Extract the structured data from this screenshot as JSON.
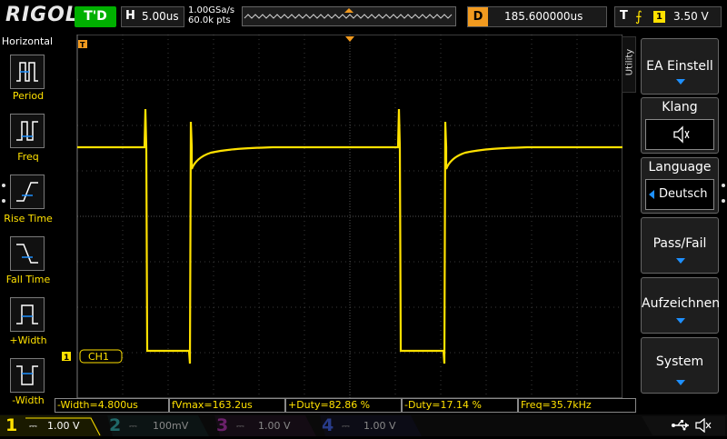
{
  "header": {
    "logo": "RIGOL",
    "run_status": "T'D",
    "timebase_label": "H",
    "timebase_value": "5.00us",
    "sample_rate": "1.00GSa/s",
    "memory_depth": "60.0k pts",
    "delay_label": "D",
    "delay_value": "185.600000us",
    "trigger_label": "T",
    "trigger_edge": "⨍",
    "trigger_channel": "1",
    "trigger_level": "3.50 V"
  },
  "left_panel": {
    "title": "Horizontal",
    "items": [
      {
        "label": "Period",
        "icon": "period-icon"
      },
      {
        "label": "Freq",
        "icon": "frequency-icon"
      },
      {
        "label": "Rise Time",
        "icon": "rise-time-icon"
      },
      {
        "label": "Fall Time",
        "icon": "fall-time-icon"
      },
      {
        "label": "+Width",
        "icon": "positive-width-icon"
      },
      {
        "label": "-Width",
        "icon": "negative-width-icon"
      }
    ]
  },
  "right_menu": {
    "tab": "Utility",
    "items": [
      {
        "label": "EA Einstell"
      },
      {
        "label": "Klang",
        "sub_icon": "speaker-mute-icon"
      },
      {
        "label": "Language",
        "value": "Deutsch"
      },
      {
        "label": "Pass/Fail"
      },
      {
        "label": "Aufzeichnen"
      },
      {
        "label": "System"
      }
    ]
  },
  "screen": {
    "channel_label": "CH1",
    "channel_marker": "1",
    "trigger_marker": "T"
  },
  "measurements": [
    "-Width=4.800us",
    "fVmax=163.2us",
    "+Duty=82.86 %",
    "-Duty=17.14 %",
    "Freq=35.7kHz"
  ],
  "channels": [
    {
      "num": "1",
      "scale": "1.00 V",
      "color": "#ffe100",
      "active": true
    },
    {
      "num": "2",
      "scale": "100mV",
      "color": "#00c0c0",
      "active": false
    },
    {
      "num": "3",
      "scale": "1.00 V",
      "color": "#e000e0",
      "active": false
    },
    {
      "num": "4",
      "scale": "1.00 V",
      "color": "#2060ff",
      "active": false
    }
  ],
  "colors": {
    "ch1": "#ffe100",
    "accent": "#f19a1f",
    "run": "#00b000"
  }
}
